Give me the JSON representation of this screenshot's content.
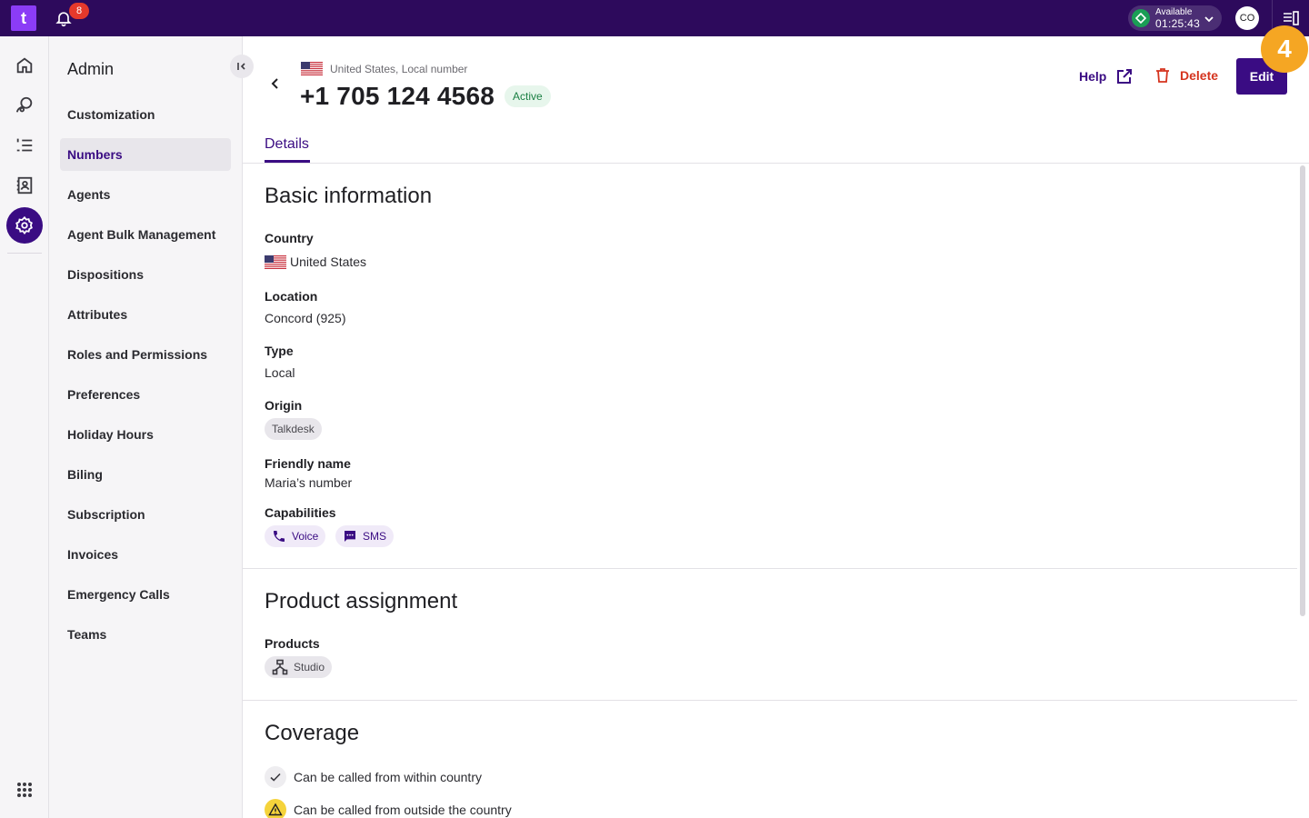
{
  "topbar": {
    "logo": "t",
    "notifications_count": "8",
    "status_label": "Available",
    "status_timer": "01:25:43",
    "avatar_initials": "CO"
  },
  "sidebar": {
    "title": "Admin",
    "items": [
      {
        "label": "Customization"
      },
      {
        "label": "Numbers",
        "active": true
      },
      {
        "label": "Agents"
      },
      {
        "label": "Agent Bulk Management"
      },
      {
        "label": "Dispositions"
      },
      {
        "label": "Attributes"
      },
      {
        "label": "Roles and Permissions"
      },
      {
        "label": "Preferences"
      },
      {
        "label": "Holiday Hours"
      },
      {
        "label": "Biling"
      },
      {
        "label": "Subscription"
      },
      {
        "label": "Invoices"
      },
      {
        "label": "Emergency Calls"
      },
      {
        "label": "Teams"
      }
    ]
  },
  "header": {
    "subtitle": "United States, Local number",
    "phone_number": "+1 705 124 4568",
    "status_tag": "Active",
    "help_label": "Help",
    "delete_label": "Delete",
    "edit_label": "Edit",
    "step_number": "4"
  },
  "tabs": [
    {
      "label": "Details"
    }
  ],
  "basic": {
    "title": "Basic information",
    "country_label": "Country",
    "country_value": "United States",
    "location_label": "Location",
    "location_value": "Concord (925)",
    "type_label": "Type",
    "type_value": "Local",
    "origin_label": "Origin",
    "origin_value": "Talkdesk",
    "friendly_label": "Friendly name",
    "friendly_value": "Maria’s number",
    "capabilities_label": "Capabilities",
    "capabilities": [
      "Voice",
      "SMS"
    ]
  },
  "product": {
    "title": "Product assignment",
    "products_label": "Products",
    "products": [
      "Studio"
    ]
  },
  "coverage": {
    "title": "Coverage",
    "items": [
      {
        "label": "Can be called from within country",
        "status": "ok"
      },
      {
        "label": "Can be called from outside the country",
        "status": "warning"
      }
    ]
  },
  "colors": {
    "brand": "#2d0a5c",
    "accent": "#3a0c83",
    "danger": "#d5341f",
    "success": "#1a7f43",
    "highlight": "#f5a623"
  }
}
